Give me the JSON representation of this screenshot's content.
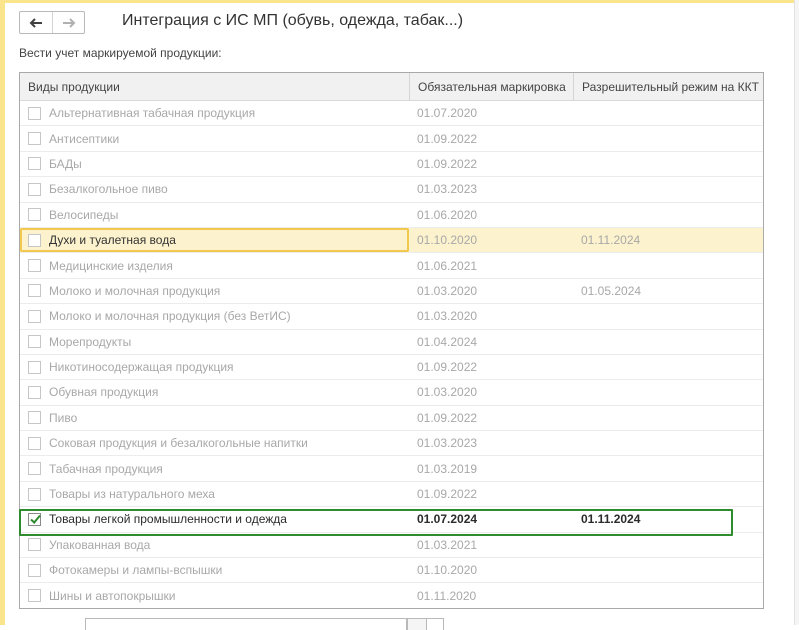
{
  "window": {
    "title": "Интеграция с ИС МП (обувь, одежда, табак...)"
  },
  "nav": {
    "back_icon": "arrow-left-icon",
    "forward_icon": "arrow-right-icon"
  },
  "caption": "Вести учет маркируемой продукции:",
  "table": {
    "columns": [
      "Виды продукции",
      "Обязательная маркировка",
      "Разрешительный режим на ККТ"
    ],
    "rows": [
      {
        "label": "Альтернативная табачная продукция",
        "mandatory": "01.07.2020",
        "permit": "",
        "checked": false
      },
      {
        "label": "Антисептики",
        "mandatory": "01.09.2022",
        "permit": "",
        "checked": false
      },
      {
        "label": "БАДы",
        "mandatory": "01.09.2022",
        "permit": "",
        "checked": false
      },
      {
        "label": "Безалкогольное пиво",
        "mandatory": "01.03.2023",
        "permit": "",
        "checked": false
      },
      {
        "label": "Велосипеды",
        "mandatory": "01.06.2020",
        "permit": "",
        "checked": false
      },
      {
        "label": "Духи и туалетная вода",
        "mandatory": "01.10.2020",
        "permit": "01.11.2024",
        "checked": false
      },
      {
        "label": "Медицинские изделия",
        "mandatory": "01.06.2021",
        "permit": "",
        "checked": false
      },
      {
        "label": "Молоко и молочная продукция",
        "mandatory": "01.03.2020",
        "permit": "01.05.2024",
        "checked": false
      },
      {
        "label": "Молоко и молочная продукция (без ВетИС)",
        "mandatory": "01.03.2020",
        "permit": "",
        "checked": false
      },
      {
        "label": "Морепродукты",
        "mandatory": "01.04.2024",
        "permit": "",
        "checked": false
      },
      {
        "label": "Никотиносодержащая продукция",
        "mandatory": "01.09.2022",
        "permit": "",
        "checked": false
      },
      {
        "label": "Обувная продукция",
        "mandatory": "01.03.2020",
        "permit": "",
        "checked": false
      },
      {
        "label": "Пиво",
        "mandatory": "01.09.2022",
        "permit": "",
        "checked": false
      },
      {
        "label": "Соковая продукция и безалкогольные напитки",
        "mandatory": "01.03.2023",
        "permit": "",
        "checked": false
      },
      {
        "label": "Табачная продукция",
        "mandatory": "01.03.2019",
        "permit": "",
        "checked": false
      },
      {
        "label": "Товары из натурального меха",
        "mandatory": "01.09.2022",
        "permit": "",
        "checked": false
      },
      {
        "label": "Товары легкой промышленности и одежда",
        "mandatory": "01.07.2024",
        "permit": "01.11.2024",
        "checked": true
      },
      {
        "label": "Упакованная вода",
        "mandatory": "01.03.2021",
        "permit": "",
        "checked": false
      },
      {
        "label": "Фотокамеры и лампы-вспышки",
        "mandatory": "01.10.2020",
        "permit": "",
        "checked": false
      },
      {
        "label": "Шины и автопокрышки",
        "mandatory": "01.11.2020",
        "permit": "",
        "checked": false
      }
    ],
    "highlighted_row": "Духи и туалетная вода",
    "selected_row": "Товары легкой промышленности и одежда"
  },
  "colors": {
    "highlight_row": "#fcf2cd",
    "highlight_border": "#f2c94c",
    "selected_outline": "#2e8b2e",
    "checkmark": "#2e8b2e",
    "accent_stripe": "#fbe58c"
  }
}
